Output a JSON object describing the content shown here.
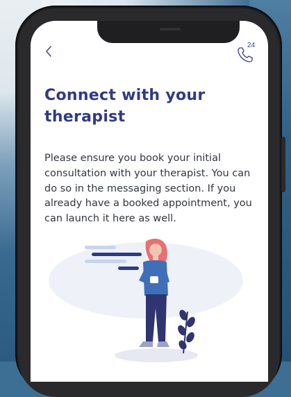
{
  "screen": {
    "back_icon": "chevron-left-icon",
    "call_icon": "phone-24-icon",
    "call_badge": "24",
    "title": "Connect with your therapist",
    "body": "Please ensure you book your initial consultation with your therapist. You can do so in the messaging section. If you already have a booked appointment, you can launch it here as well."
  },
  "colors": {
    "accent": "#2f3b86",
    "body_text": "#333640",
    "illustration_hair": "#e8706f",
    "illustration_top": "#3e6fb8",
    "illustration_pants": "#2f3570"
  }
}
